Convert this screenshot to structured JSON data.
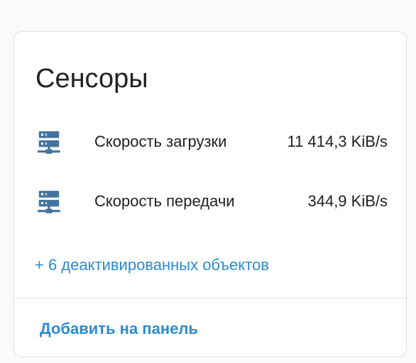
{
  "card": {
    "title": "Сенсоры",
    "sensors": [
      {
        "name": "Скорость загрузки",
        "value": "11 414,3 KiB/s",
        "icon": "server-network-icon"
      },
      {
        "name": "Скорость передачи",
        "value": "344,9 KiB/s",
        "icon": "server-network-icon"
      }
    ],
    "disabled_link": "+ 6 деактивированных объектов",
    "add_button": "Добавить на панель"
  },
  "colors": {
    "icon": "#44739e",
    "link": "#2b8ccf",
    "text": "#212121",
    "divider": "#e0e0e0"
  }
}
